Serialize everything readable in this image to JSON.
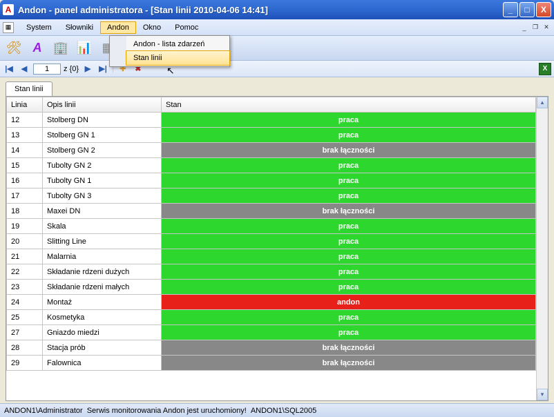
{
  "title": "Andon - panel administratora - [Stan linii   2010-04-06   14:41]",
  "appIconLetter": "A",
  "menu": {
    "items": [
      "System",
      "Słowniki",
      "Andon",
      "Okno",
      "Pomoc"
    ],
    "activeIndex": 2,
    "dropdown": {
      "items": [
        "Andon - lista zdarzeń",
        "Stan linii"
      ],
      "hoveredIndex": 1
    }
  },
  "nav": {
    "currentRecord": "1",
    "totalLabel": "z {0}"
  },
  "tab": {
    "label": "Stan linii"
  },
  "table": {
    "headers": [
      "Linia",
      "Opis linii",
      "Stan"
    ],
    "rows": [
      {
        "linia": "12",
        "opis": "Stolberg DN",
        "stan": "praca",
        "cls": "state-praca"
      },
      {
        "linia": "13",
        "opis": "Stolberg GN 1",
        "stan": "praca",
        "cls": "state-praca"
      },
      {
        "linia": "14",
        "opis": "Stolberg GN 2",
        "stan": "brak łączności",
        "cls": "state-brak"
      },
      {
        "linia": "15",
        "opis": "Tubolty GN 2",
        "stan": "praca",
        "cls": "state-praca"
      },
      {
        "linia": "16",
        "opis": "Tubolty GN 1",
        "stan": "praca",
        "cls": "state-praca"
      },
      {
        "linia": "17",
        "opis": "Tubolty GN 3",
        "stan": "praca",
        "cls": "state-praca"
      },
      {
        "linia": "18",
        "opis": "Maxei DN",
        "stan": "brak łączności",
        "cls": "state-brak"
      },
      {
        "linia": "19",
        "opis": "Skala",
        "stan": "praca",
        "cls": "state-praca"
      },
      {
        "linia": "20",
        "opis": "Slitting Line",
        "stan": "praca",
        "cls": "state-praca"
      },
      {
        "linia": "21",
        "opis": "Malarnia",
        "stan": "praca",
        "cls": "state-praca"
      },
      {
        "linia": "22",
        "opis": "Składanie rdzeni dużych",
        "stan": "praca",
        "cls": "state-praca"
      },
      {
        "linia": "23",
        "opis": "Składanie rdzeni małych",
        "stan": "praca",
        "cls": "state-praca"
      },
      {
        "linia": "24",
        "opis": "Montaż",
        "stan": "andon",
        "cls": "state-andon"
      },
      {
        "linia": "25",
        "opis": "Kosmetyka",
        "stan": "praca",
        "cls": "state-praca"
      },
      {
        "linia": "27",
        "opis": "Gniazdo miedzi",
        "stan": "praca",
        "cls": "state-praca"
      },
      {
        "linia": "28",
        "opis": "Stacja prób",
        "stan": "brak łączności",
        "cls": "state-brak"
      },
      {
        "linia": "29",
        "opis": "Falownica",
        "stan": "brak łączności",
        "cls": "state-brak"
      }
    ]
  },
  "status": {
    "userHost": "ANDON1\\Administrator",
    "serviceMsg": "Serwis monitorowania Andon jest uruchomiony!",
    "db": "ANDON1\\SQL2005"
  }
}
